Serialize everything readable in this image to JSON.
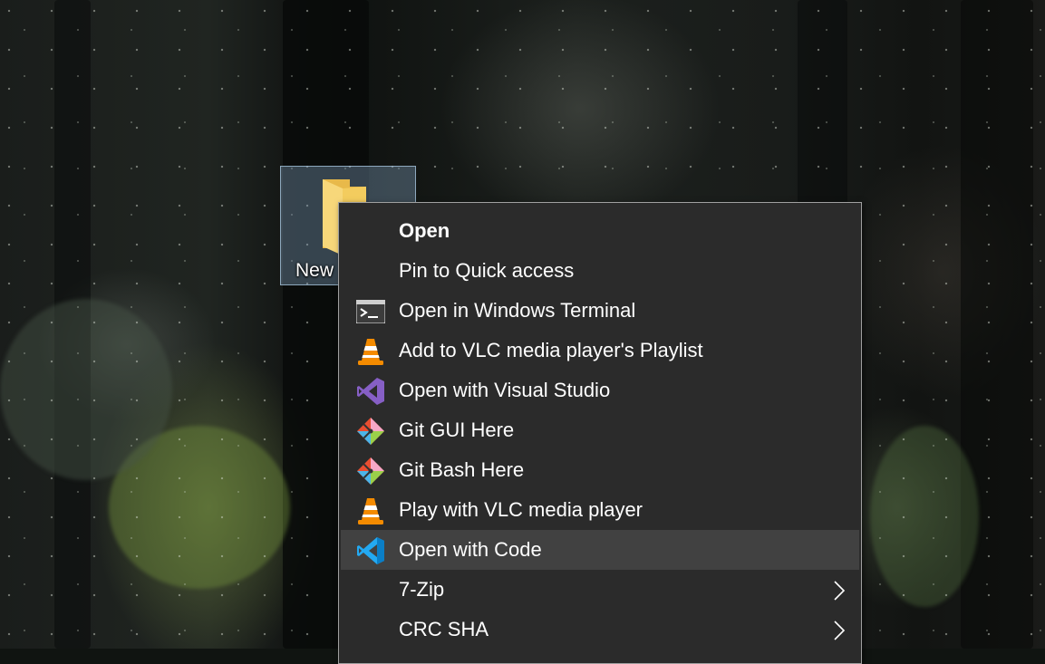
{
  "desktop": {
    "folder_label": "New"
  },
  "context_menu": {
    "items": [
      {
        "label": "Open",
        "icon": null,
        "bold": true
      },
      {
        "label": "Pin to Quick access",
        "icon": null
      },
      {
        "label": "Open in Windows Terminal",
        "icon": "terminal-icon"
      },
      {
        "label": "Add to VLC media player's Playlist",
        "icon": "vlc-icon"
      },
      {
        "label": "Open with Visual Studio",
        "icon": "visual-studio-icon"
      },
      {
        "label": "Git GUI Here",
        "icon": "git-gui-icon"
      },
      {
        "label": "Git Bash Here",
        "icon": "git-bash-icon"
      },
      {
        "label": "Play with VLC media player",
        "icon": "vlc-icon"
      },
      {
        "label": "Open with Code",
        "icon": "vscode-icon",
        "highlighted": true
      },
      {
        "label": "7-Zip",
        "icon": null,
        "submenu": true
      },
      {
        "label": "CRC SHA",
        "icon": null,
        "submenu": true
      }
    ]
  },
  "colors": {
    "menu_background": "#2b2b2b",
    "menu_highlight": "#414141",
    "menu_border": "#a0a0a0",
    "selection_fill": "#82a0be",
    "vlc_orange": "#f48b00",
    "visual_studio_purple": "#865fc5",
    "vscode_blue": "#23a9f2"
  }
}
